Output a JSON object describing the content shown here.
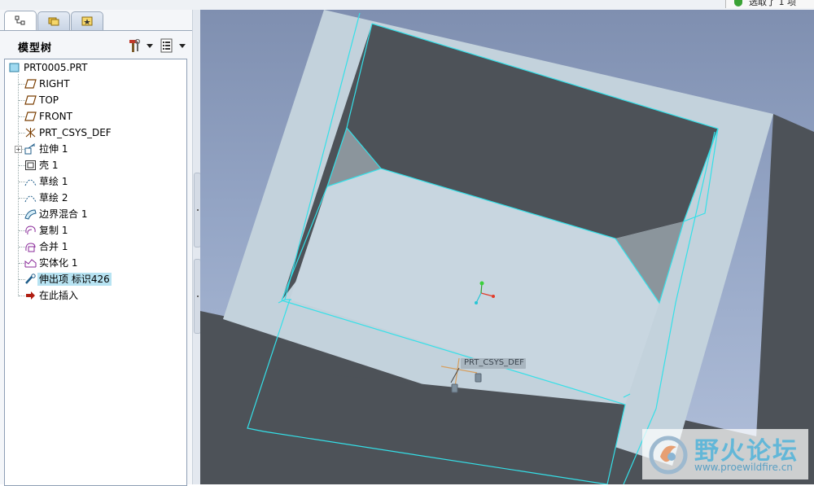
{
  "status": {
    "text": "选取了 1 项"
  },
  "tabs": [
    {
      "name": "model-tree-tab",
      "icon": "tree-tab-icon"
    },
    {
      "name": "folder-browser-tab",
      "icon": "folders-tab-icon"
    },
    {
      "name": "favorites-tab",
      "icon": "favorites-tab-icon"
    }
  ],
  "panel": {
    "title": "模型树"
  },
  "tree": {
    "items": [
      {
        "label": "PRT0005.PRT",
        "icon": "part-icon"
      },
      {
        "label": "RIGHT",
        "icon": "datum-plane-icon"
      },
      {
        "label": "TOP",
        "icon": "datum-plane-icon"
      },
      {
        "label": "FRONT",
        "icon": "datum-plane-icon"
      },
      {
        "label": "PRT_CSYS_DEF",
        "icon": "csys-icon"
      },
      {
        "label": "拉伸 1",
        "icon": "extrude-icon"
      },
      {
        "label": "壳 1",
        "icon": "shell-icon"
      },
      {
        "label": "草绘 1",
        "icon": "sketch-icon"
      },
      {
        "label": "草绘 2",
        "icon": "sketch-icon"
      },
      {
        "label": "边界混合 1",
        "icon": "boundary-blend-icon"
      },
      {
        "label": "复制 1",
        "icon": "copy-icon"
      },
      {
        "label": "合并 1",
        "icon": "merge-icon"
      },
      {
        "label": "实体化 1",
        "icon": "solidify-icon"
      },
      {
        "label": "伸出项 标识426",
        "icon": "protrusion-icon"
      },
      {
        "label": "在此插入",
        "icon": "insert-here-icon"
      }
    ],
    "selected_index": 13
  },
  "viewport": {
    "csys_label": "PRT_CSYS_DEF"
  },
  "watermark": {
    "title": "野火论坛",
    "url": "www.proewildfire.cn"
  },
  "colors": {
    "selection": "#b7e3f2",
    "edge_highlight": "#34e0e8",
    "surface_light": "#c3d2dc",
    "surface_dark": "#4d5258"
  }
}
